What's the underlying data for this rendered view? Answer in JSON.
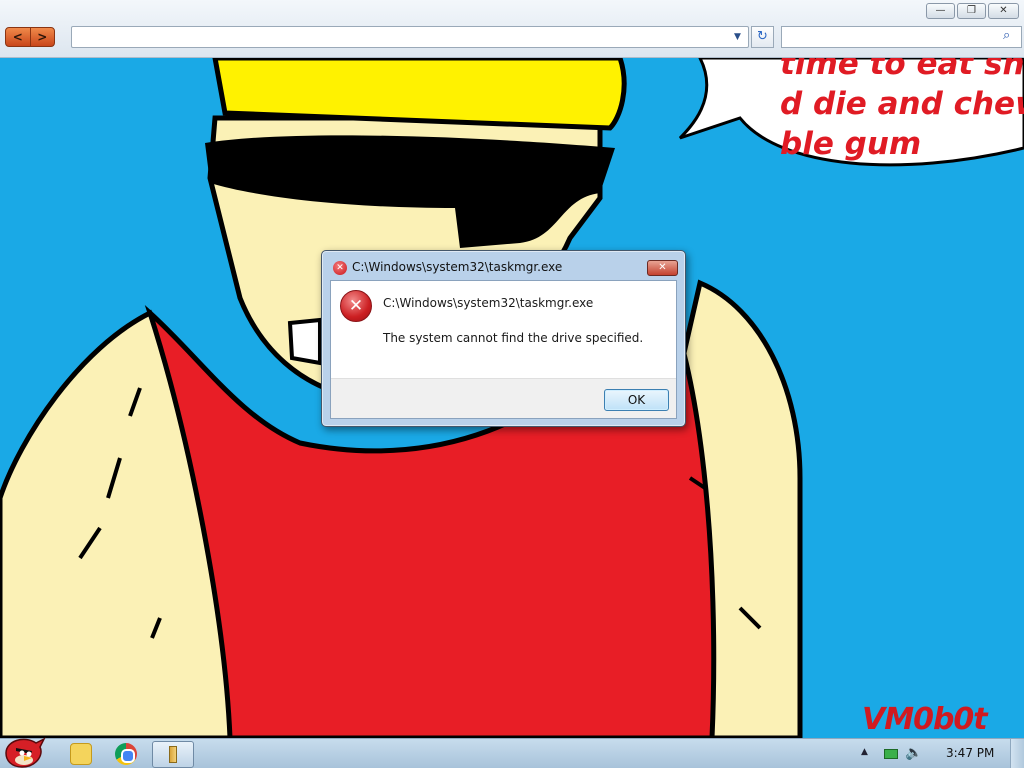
{
  "browser": {
    "address_value": "",
    "search_value": "",
    "nav_back_glyph": "<",
    "nav_forward_glyph": ">",
    "dropdown_glyph": "▼",
    "refresh_glyph": "↻",
    "search_glyph": "⌕",
    "window_controls": {
      "minimize": "—",
      "maximize": "❐",
      "close": "✕"
    }
  },
  "wallpaper": {
    "speech_bubble_lines": [
      "time to eat shit",
      "d die and chew",
      "ble gum"
    ],
    "watermark": "VM0b0t",
    "colors": {
      "sky": "#1aa9e6",
      "skin": "#fbf1b6",
      "shirt": "#e81e26",
      "hat": "#fff200",
      "outline": "#000000"
    }
  },
  "dialog": {
    "title": "C:\\Windows\\system32\\taskmgr.exe",
    "heading": "C:\\Windows\\system32\\taskmgr.exe",
    "message": "The system cannot find the drive specified.",
    "ok_label": "OK",
    "close_glyph": "✕",
    "error_glyph": "✕"
  },
  "taskbar": {
    "clock": "3:47 PM",
    "tray_expand_glyph": "▲",
    "volume_glyph": "🔈"
  }
}
